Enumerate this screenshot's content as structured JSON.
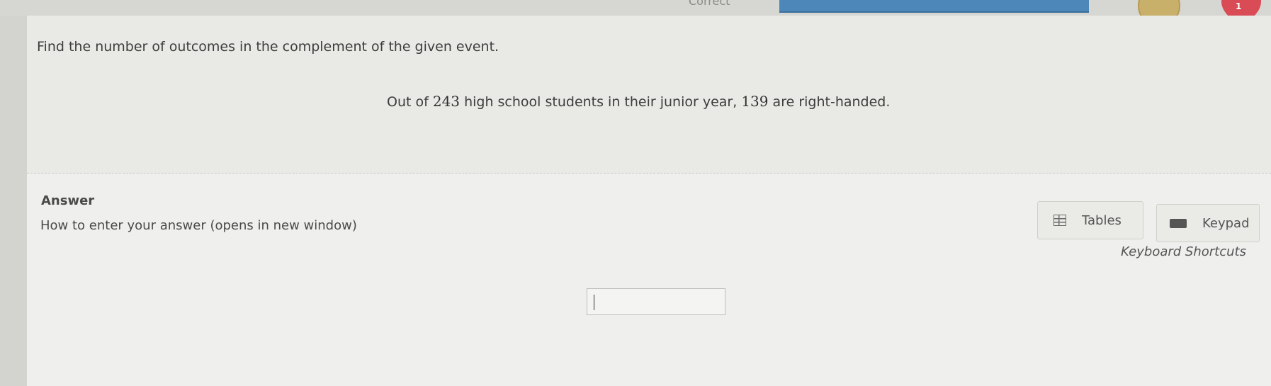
{
  "header": {
    "status_text": "Correct",
    "hearts_count": "1",
    "icons": {
      "coin": "coin-icon",
      "heart": "heart-icon"
    },
    "colors": {
      "progress": "#4d86b8",
      "heart": "#d94b55",
      "coin": "#c9b06a"
    }
  },
  "question": {
    "prompt": "Find the number of outcomes in the complement of the given event.",
    "problem": {
      "prefix": "Out of ",
      "total": "243",
      "middle": " high school students in their junior year, ",
      "count": "139",
      "suffix": " are right-handed."
    }
  },
  "answer": {
    "heading": "Answer",
    "help_link": "How to enter your answer (opens in new window)",
    "tables_label": "Tables",
    "keypad_label": "Keypad",
    "shortcuts_label": "Keyboard Shortcuts",
    "input_value": ""
  }
}
